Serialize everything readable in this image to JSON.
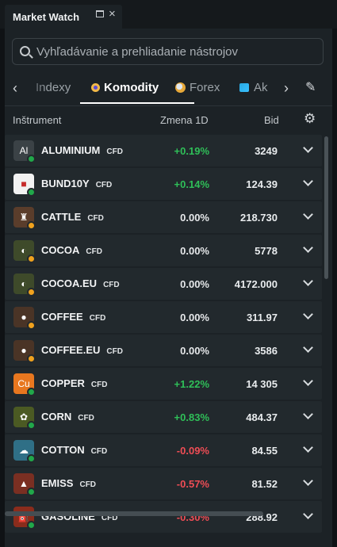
{
  "window": {
    "title": "Market Watch",
    "maximize_glyph": "",
    "close_glyph": "×"
  },
  "search": {
    "placeholder": "Vyhľadávanie a prehliadanie nástrojov"
  },
  "tabs": {
    "prev_glyph": "‹",
    "next_glyph": "›",
    "items": [
      {
        "label": "Indexy",
        "icon": "none"
      },
      {
        "label": "Komodity",
        "icon": "komodity-icon",
        "active": true
      },
      {
        "label": "Forex",
        "icon": "forex-icon"
      },
      {
        "label": "Ak",
        "icon": "akcie-icon"
      }
    ],
    "edit_glyph": "✎"
  },
  "table": {
    "headers": {
      "instrument": "Inštrument",
      "change": "Zmena 1D",
      "bid": "Bid"
    },
    "settings_glyph": "⚙",
    "rows": [
      {
        "symbol": "ALUMINIUM",
        "type": "CFD",
        "change": "+0.19%",
        "bid": "3249",
        "logo_text": "Al",
        "logo_bg": "#3b4246",
        "dot": "#21a84a",
        "trend": "up"
      },
      {
        "symbol": "BUND10Y",
        "type": "CFD",
        "change": "+0.14%",
        "bid": "124.39",
        "logo_text": "■",
        "logo_bg": "#f2f2f2",
        "dot": "#21a84a",
        "trend": "up"
      },
      {
        "symbol": "CATTLE",
        "type": "CFD",
        "change": "0.00%",
        "bid": "218.730",
        "logo_text": "♜",
        "logo_bg": "#5a3d2b",
        "dot": "#f0a21e",
        "trend": "flat"
      },
      {
        "symbol": "COCOA",
        "type": "CFD",
        "change": "0.00%",
        "bid": "5778",
        "logo_text": "◐",
        "logo_bg": "#3e4a2a",
        "dot": "#f0a21e",
        "trend": "flat"
      },
      {
        "symbol": "COCOA.EU",
        "type": "CFD",
        "change": "0.00%",
        "bid": "4172.000",
        "logo_text": "◐",
        "logo_bg": "#3e4a2a",
        "dot": "#f0a21e",
        "trend": "flat"
      },
      {
        "symbol": "COFFEE",
        "type": "CFD",
        "change": "0.00%",
        "bid": "311.97",
        "logo_text": "●",
        "logo_bg": "#4a3426",
        "dot": "#f0a21e",
        "trend": "flat"
      },
      {
        "symbol": "COFFEE.EU",
        "type": "CFD",
        "change": "0.00%",
        "bid": "3586",
        "logo_text": "●",
        "logo_bg": "#4a3426",
        "dot": "#f0a21e",
        "trend": "flat"
      },
      {
        "symbol": "COPPER",
        "type": "CFD",
        "change": "+1.22%",
        "bid": "14 305",
        "logo_text": "Cu",
        "logo_bg": "#e8771f",
        "dot": "#21a84a",
        "trend": "up"
      },
      {
        "symbol": "CORN",
        "type": "CFD",
        "change": "+0.83%",
        "bid": "484.37",
        "logo_text": "✿",
        "logo_bg": "#4b5a23",
        "dot": "#21a84a",
        "trend": "up"
      },
      {
        "symbol": "COTTON",
        "type": "CFD",
        "change": "-0.09%",
        "bid": "84.55",
        "logo_text": "☁",
        "logo_bg": "#2f6f86",
        "dot": "#21a84a",
        "trend": "down"
      },
      {
        "symbol": "EMISS",
        "type": "CFD",
        "change": "-0.57%",
        "bid": "81.52",
        "logo_text": "▲",
        "logo_bg": "#7a2f22",
        "dot": "#21a84a",
        "trend": "down"
      },
      {
        "symbol": "GASOLINE",
        "type": "CFD",
        "change": "-0.30%",
        "bid": "288.92",
        "logo_text": "⛽",
        "logo_bg": "#8a2c1c",
        "dot": "#21a84a",
        "trend": "down"
      }
    ]
  },
  "colors": {
    "up": "#2fbf58",
    "down": "#ef4d55",
    "flat": "#e6e8ea"
  }
}
